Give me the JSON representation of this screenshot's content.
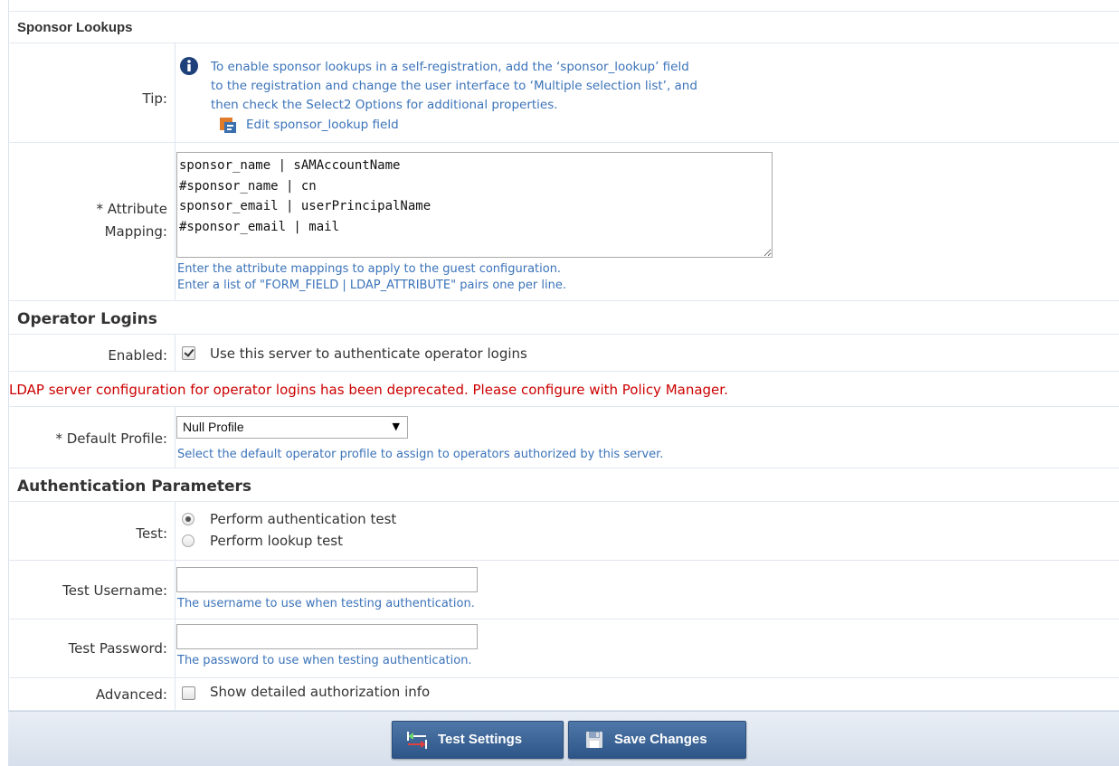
{
  "sponsor_lookups": {
    "title": "Sponsor Lookups",
    "tip_label": "Tip:",
    "tip_lines": [
      "To enable sponsor lookups in a self-registration, add the ‘sponsor_lookup’ field",
      "to the registration and change the user interface to ‘Multiple selection list’, and",
      "then check the Select2 Options for additional properties."
    ],
    "edit_link": "Edit sponsor_lookup field",
    "attr_label_1": "* Attribute",
    "attr_label_2": "Mapping:",
    "attr_mapping_value": "sponsor_name | sAMAccountName\n#sponsor_name | cn\nsponsor_email | userPrincipalName\n#sponsor_email | mail",
    "attr_hint_1": "Enter the attribute mappings to apply to the guest configuration.",
    "attr_hint_2": "Enter a list of \"FORM_FIELD | LDAP_ATTRIBUTE\" pairs one per line."
  },
  "operator_logins": {
    "title": "Operator Logins",
    "enabled_label": "Enabled:",
    "enabled_checked": true,
    "enabled_text": "Use this server to authenticate operator logins",
    "deprecation_warning": "LDAP server configuration for operator logins has been deprecated. Please configure with Policy Manager.",
    "default_profile_label": "* Default Profile:",
    "default_profile_value": "Null Profile",
    "default_profile_hint": "Select the default operator profile to assign to operators authorized by this server."
  },
  "auth_params": {
    "title": "Authentication Parameters",
    "test_label": "Test:",
    "test_options": [
      "Perform authentication test",
      "Perform lookup test"
    ],
    "selected_test": 0,
    "username_label": "Test Username:",
    "username_value": "",
    "username_hint": "The username to use when testing authentication.",
    "password_label": "Test Password:",
    "password_value": "",
    "password_hint": "The password to use when testing authentication.",
    "advanced_label": "Advanced:",
    "advanced_checked": false,
    "advanced_text": "Show detailed authorization info"
  },
  "buttons": {
    "test_settings": "Test Settings",
    "save_changes": "Save Changes"
  },
  "colors": {
    "hint": "#3b73b9",
    "warning": "#cc0000",
    "button": "#3a5f90",
    "info_icon": "#1d3f7a"
  }
}
